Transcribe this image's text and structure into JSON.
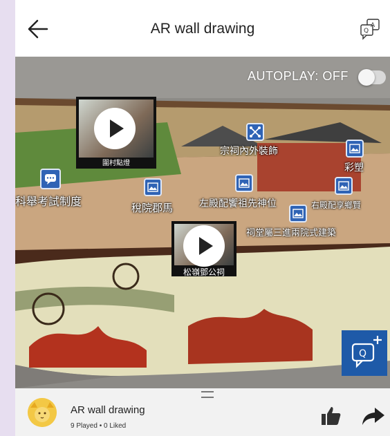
{
  "header": {
    "title": "AR wall drawing"
  },
  "scene": {
    "autoplay_label": "AUTOPLAY: OFF",
    "autoplay_on": false,
    "videos": [
      {
        "caption": "圍村點燈"
      },
      {
        "caption": "松嶺鄧公祠"
      }
    ],
    "hotspots": [
      {
        "label": "科舉考試制度",
        "icon": "chat-icon"
      },
      {
        "label": "稅院郡馬",
        "icon": "image-icon"
      },
      {
        "label": "宗祠內外裝飾",
        "icon": "shuffle-icon"
      },
      {
        "label": "彩塑",
        "icon": "image-icon"
      },
      {
        "label": "左殿配饗祖先神位",
        "icon": "image-icon"
      },
      {
        "label": "右殿配享鄉賢",
        "icon": "image-icon"
      },
      {
        "label": "祠堂屬三進兩院式建築",
        "icon": "image-icon"
      }
    ]
  },
  "footer": {
    "title": "AR wall drawing",
    "stats": "9 Played • 0 Liked"
  },
  "colors": {
    "accent": "#1e5aa8",
    "hotspot": "#2f63b5",
    "background": "#e7def0"
  }
}
